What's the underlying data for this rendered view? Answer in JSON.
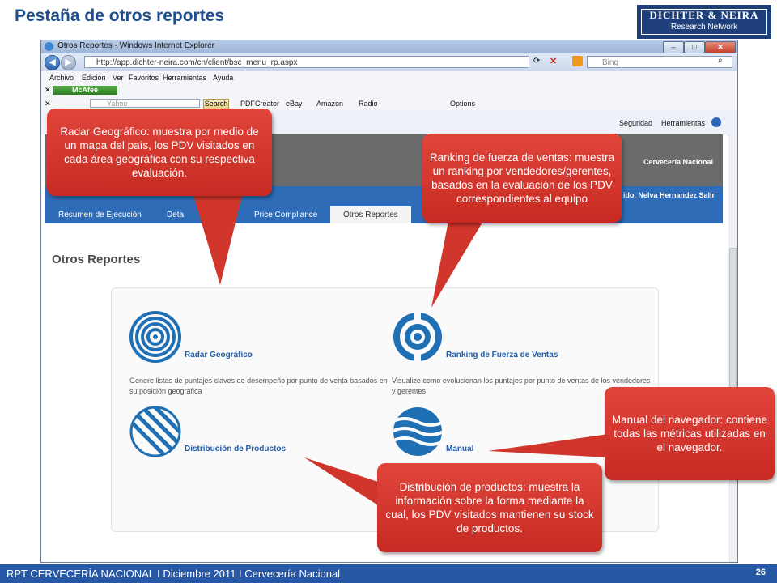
{
  "slide": {
    "title": "Pestaña de otros reportes",
    "logo_line1": "DICHTER & NEIRA",
    "logo_line2": "Research Network",
    "footer_text": "RPT CERVECERÍA NACIONAL I Diciembre 2011 I Cervecería Nacional",
    "page_number": "26"
  },
  "browser": {
    "window_title": "Otros Reportes - Windows Internet Explorer",
    "url": "http://app.dichter-neira.com/cn/client/bsc_menu_rp.aspx",
    "search_engine": "Bing",
    "menu": [
      "Archivo",
      "Edición",
      "Ver",
      "Favoritos",
      "Herramientas",
      "Ayuda"
    ],
    "mcafee_label": "McAfee",
    "yahoo_placeholder": "Yahoo",
    "search_button": "Search",
    "toolbar_links": [
      "PDFCreator",
      "eBay",
      "Amazon",
      "Radio",
      "Options"
    ],
    "command_items": [
      "Seguridad",
      "Herramientas"
    ]
  },
  "app": {
    "brand": "Cervecería Nacional",
    "welcome_prefix": "ido,",
    "user_name": "Nelva Hernandez",
    "logout": "Salir",
    "tabs": [
      "Resumen de Ejecución",
      "Deta",
      "Price Compliance",
      "Otros Reportes"
    ],
    "active_tab": "Otros Reportes",
    "page_heading": "Otros Reportes"
  },
  "reports": [
    {
      "name": "Radar Geográfico",
      "description": "Genere listas de puntajes claves de desempeño por punto de venta basados en su posición geográfica",
      "icon": "radar-icon"
    },
    {
      "name": "Ranking de Fuerza de Ventas",
      "description": "Visualize como evolucionan los puntajes por punto de ventas de los vendedores y gerentes",
      "icon": "ranking-icon"
    },
    {
      "name": "Distribución de Productos",
      "description": "",
      "icon": "distribution-icon"
    },
    {
      "name": "Manual",
      "description": "",
      "icon": "manual-icon"
    }
  ],
  "callouts": {
    "radar": "Radar Geográfico:  muestra por medio de un mapa del país, los PDV visitados en cada área geográfica con su respectiva evaluación.",
    "ranking": "Ranking de fuerza de ventas: muestra un ranking por vendedores/gerentes, basados en la evaluación de los PDV correspondientes al equipo",
    "manual": "Manual del navegador: contiene todas las métricas utilizadas en el navegador.",
    "distribution": "Distribución de productos: muestra la información sobre la forma mediante la cual, los PDV visitados mantienen su stock de productos."
  },
  "colors": {
    "callout_red": "#d1362c",
    "nav_blue": "#2e6cb8",
    "footer_blue": "#2658a6",
    "title_blue": "#1f4e8c",
    "icon_blue": "#1f6fb5"
  }
}
